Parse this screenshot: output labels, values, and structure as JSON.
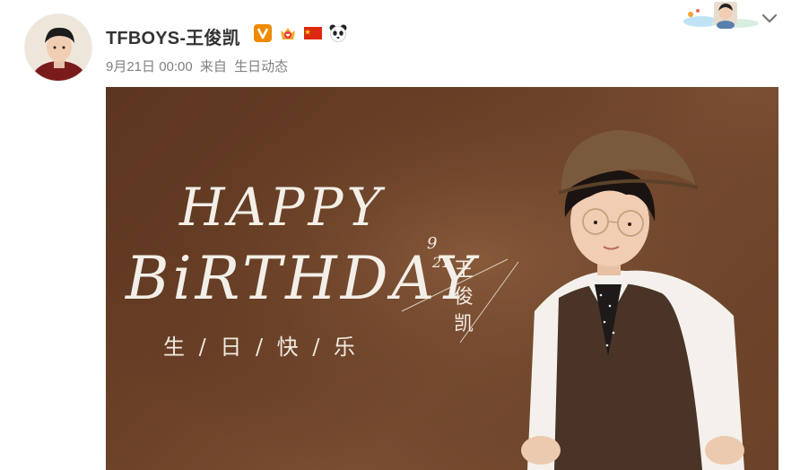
{
  "post": {
    "author": "TFBOYS-王俊凯",
    "time": "9月21日 00:00",
    "via_prefix": "来自",
    "source": "生日动态",
    "badges": [
      "verified-v-icon",
      "crown-medal-icon",
      "china-flag-icon",
      "panda-icon"
    ]
  },
  "image": {
    "line1": "HAPPY",
    "line2": "BiRTHDAY",
    "cn_line": "生 / 日 / 快 / 乐",
    "date_month": "9",
    "date_day": "21",
    "name_vertical": "王俊凯"
  },
  "colors": {
    "accent_orange": "#f08a00",
    "image_bg": "#6b4127",
    "text_light": "#f3efe8"
  }
}
